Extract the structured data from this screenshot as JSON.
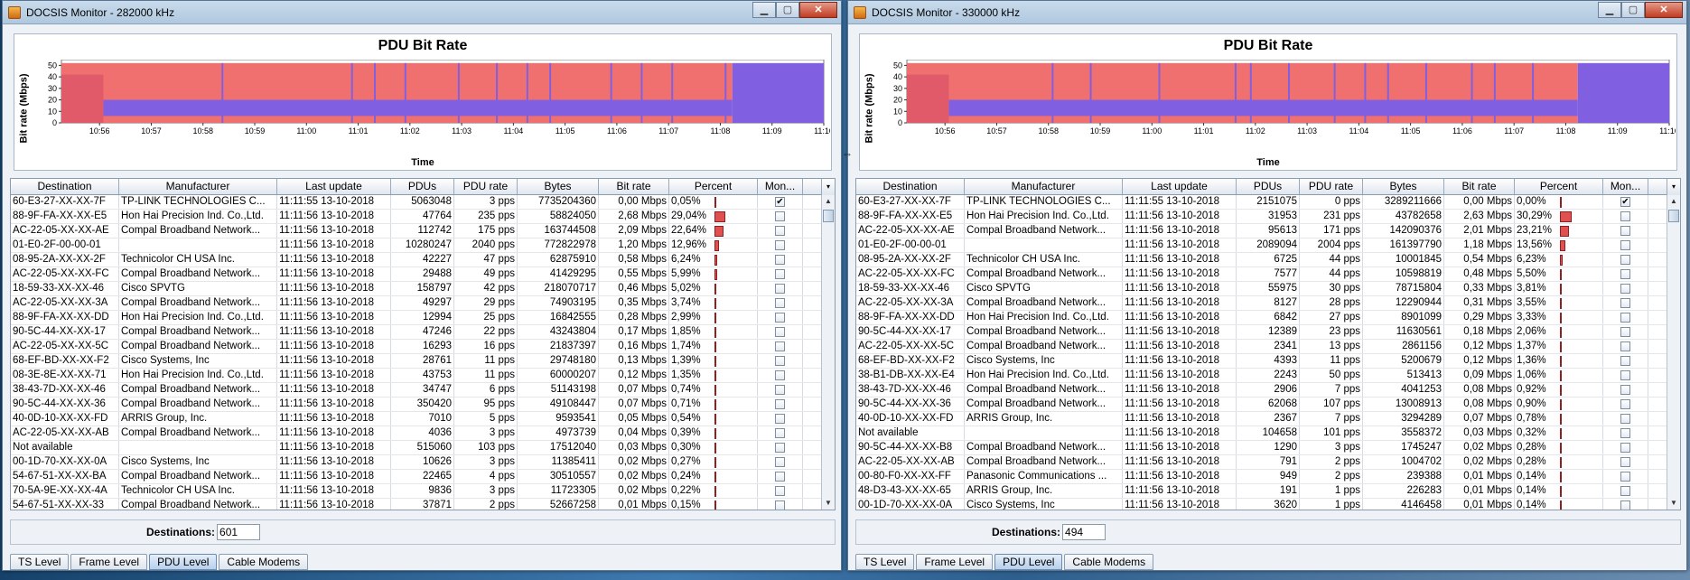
{
  "columns": [
    "Destination",
    "Manufacturer",
    "Last update",
    "PDUs",
    "PDU rate",
    "Bytes",
    "Bit rate",
    "Percent",
    "Mon..."
  ],
  "tabs": [
    "TS Level",
    "Frame Level",
    "PDU Level",
    "Cable Modems"
  ],
  "active_tab": "PDU Level",
  "dest_label": "Destinations:",
  "colors": {
    "series_data": "#f07070",
    "series_other": "#8060e0",
    "bar_red": "#e05050"
  },
  "windows": [
    {
      "title": "DOCSIS Monitor - 282000 kHz",
      "destinations": "601",
      "chart_data": {
        "type": "area",
        "title": "PDU Bit Rate",
        "ylabel": "Bit rate (Mbps)",
        "xlabel": "Time",
        "ylim": [
          0,
          55
        ],
        "yticks": [
          "0",
          "10",
          "20",
          "30",
          "40",
          "50"
        ],
        "xticks": [
          "10:56",
          "10:57",
          "10:58",
          "10:59",
          "11:00",
          "11:01",
          "11:02",
          "11:03",
          "11:04",
          "11:05",
          "11:06",
          "11:07",
          "11:08",
          "11:09",
          "11:10"
        ],
        "series": [
          {
            "name": "",
            "values": []
          }
        ],
        "legend": "none",
        "grid": false
      },
      "rows": [
        [
          "60-E3-27-XX-XX-7F",
          "TP-LINK TECHNOLOGIES C...",
          "11:11:55  13-10-2018",
          "5063048",
          "3 pps",
          "7735204360",
          "0,00 Mbps",
          "0,05%",
          true
        ],
        [
          "88-9F-FA-XX-XX-E5",
          "Hon Hai Precision Ind. Co.,Ltd.",
          "11:11:56  13-10-2018",
          "47764",
          "235 pps",
          "58824050",
          "2,68 Mbps",
          "29,04%",
          false
        ],
        [
          "AC-22-05-XX-XX-AE",
          "Compal Broadband Network...",
          "11:11:56  13-10-2018",
          "112742",
          "175 pps",
          "163744508",
          "2,09 Mbps",
          "22,64%",
          false
        ],
        [
          "01-E0-2F-00-00-01",
          "",
          "11:11:56  13-10-2018",
          "10280247",
          "2040 pps",
          "772822978",
          "1,20 Mbps",
          "12,96%",
          false
        ],
        [
          "08-95-2A-XX-XX-2F",
          "Technicolor CH USA Inc.",
          "11:11:56  13-10-2018",
          "42227",
          "47 pps",
          "62875910",
          "0,58 Mbps",
          "6,24%",
          false
        ],
        [
          "AC-22-05-XX-XX-FC",
          "Compal Broadband Network...",
          "11:11:56  13-10-2018",
          "29488",
          "49 pps",
          "41429295",
          "0,55 Mbps",
          "5,99%",
          false
        ],
        [
          "18-59-33-XX-XX-46",
          "Cisco SPVTG",
          "11:11:56  13-10-2018",
          "158797",
          "42 pps",
          "218070717",
          "0,46 Mbps",
          "5,02%",
          false
        ],
        [
          "AC-22-05-XX-XX-3A",
          "Compal Broadband Network...",
          "11:11:56  13-10-2018",
          "49297",
          "29 pps",
          "74903195",
          "0,35 Mbps",
          "3,74%",
          false
        ],
        [
          "88-9F-FA-XX-XX-DD",
          "Hon Hai Precision Ind. Co.,Ltd.",
          "11:11:56  13-10-2018",
          "12994",
          "25 pps",
          "16842555",
          "0,28 Mbps",
          "2,99%",
          false
        ],
        [
          "90-5C-44-XX-XX-17",
          "Compal Broadband Network...",
          "11:11:56  13-10-2018",
          "47246",
          "22 pps",
          "43243804",
          "0,17 Mbps",
          "1,85%",
          false
        ],
        [
          "AC-22-05-XX-XX-5C",
          "Compal Broadband Network...",
          "11:11:56  13-10-2018",
          "16293",
          "16 pps",
          "21837397",
          "0,16 Mbps",
          "1,74%",
          false
        ],
        [
          "68-EF-BD-XX-XX-F2",
          "Cisco Systems, Inc",
          "11:11:56  13-10-2018",
          "28761",
          "11 pps",
          "29748180",
          "0,13 Mbps",
          "1,39%",
          false
        ],
        [
          "08-3E-8E-XX-XX-71",
          "Hon Hai Precision Ind. Co.,Ltd.",
          "11:11:56  13-10-2018",
          "43753",
          "11 pps",
          "60000207",
          "0,12 Mbps",
          "1,35%",
          false
        ],
        [
          "38-43-7D-XX-XX-46",
          "Compal Broadband Network...",
          "11:11:56  13-10-2018",
          "34747",
          "6 pps",
          "51143198",
          "0,07 Mbps",
          "0,74%",
          false
        ],
        [
          "90-5C-44-XX-XX-36",
          "Compal Broadband Network...",
          "11:11:56  13-10-2018",
          "350420",
          "95 pps",
          "49108447",
          "0,07 Mbps",
          "0,71%",
          false
        ],
        [
          "40-0D-10-XX-XX-FD",
          "ARRIS Group, Inc.",
          "11:11:56  13-10-2018",
          "7010",
          "5 pps",
          "9593541",
          "0,05 Mbps",
          "0,54%",
          false
        ],
        [
          "AC-22-05-XX-XX-AB",
          "Compal Broadband Network...",
          "11:11:56  13-10-2018",
          "4036",
          "3 pps",
          "4973739",
          "0,04 Mbps",
          "0,39%",
          false
        ],
        [
          "Not available",
          "",
          "11:11:56  13-10-2018",
          "515060",
          "103 pps",
          "17512040",
          "0,03 Mbps",
          "0,30%",
          false
        ],
        [
          "00-1D-70-XX-XX-0A",
          "Cisco Systems, Inc",
          "11:11:56  13-10-2018",
          "10626",
          "3 pps",
          "11385411",
          "0,02 Mbps",
          "0,27%",
          false
        ],
        [
          "54-67-51-XX-XX-BA",
          "Compal Broadband Network...",
          "11:11:56  13-10-2018",
          "22465",
          "4 pps",
          "30510557",
          "0,02 Mbps",
          "0,24%",
          false
        ],
        [
          "70-5A-9E-XX-XX-4A",
          "Technicolor CH USA Inc.",
          "11:11:56  13-10-2018",
          "9836",
          "3 pps",
          "11723305",
          "0,02 Mbps",
          "0,22%",
          false
        ],
        [
          "54-67-51-XX-XX-33",
          "Compal Broadband Network...",
          "11:11:56  13-10-2018",
          "37871",
          "2 pps",
          "52667258",
          "0,01 Mbps",
          "0,15%",
          false
        ]
      ]
    },
    {
      "title": "DOCSIS Monitor - 330000 kHz",
      "destinations": "494",
      "chart_data": {
        "type": "area",
        "title": "PDU Bit Rate",
        "ylabel": "Bit rate (Mbps)",
        "xlabel": "Time",
        "ylim": [
          0,
          55
        ],
        "yticks": [
          "0",
          "10",
          "20",
          "30",
          "40",
          "50"
        ],
        "xticks": [
          "10:56",
          "10:57",
          "10:58",
          "10:59",
          "11:00",
          "11:01",
          "11:02",
          "11:03",
          "11:04",
          "11:05",
          "11:06",
          "11:07",
          "11:08",
          "11:09",
          "11:10"
        ],
        "series": [
          {
            "name": "",
            "values": []
          }
        ],
        "legend": "none",
        "grid": false
      },
      "rows": [
        [
          "60-E3-27-XX-XX-7F",
          "TP-LINK TECHNOLOGIES C...",
          "11:11:55  13-10-2018",
          "2151075",
          "0 pps",
          "3289211666",
          "0,00 Mbps",
          "0,00%",
          true
        ],
        [
          "88-9F-FA-XX-XX-E5",
          "Hon Hai Precision Ind. Co.,Ltd.",
          "11:11:56  13-10-2018",
          "31953",
          "231 pps",
          "43782658",
          "2,63 Mbps",
          "30,29%",
          false
        ],
        [
          "AC-22-05-XX-XX-AE",
          "Compal Broadband Network...",
          "11:11:56  13-10-2018",
          "95613",
          "171 pps",
          "142090376",
          "2,01 Mbps",
          "23,21%",
          false
        ],
        [
          "01-E0-2F-00-00-01",
          "",
          "11:11:56  13-10-2018",
          "2089094",
          "2004 pps",
          "161397790",
          "1,18 Mbps",
          "13,56%",
          false
        ],
        [
          "08-95-2A-XX-XX-2F",
          "Technicolor CH USA Inc.",
          "11:11:56  13-10-2018",
          "6725",
          "44 pps",
          "10001845",
          "0,54 Mbps",
          "6,23%",
          false
        ],
        [
          "AC-22-05-XX-XX-FC",
          "Compal Broadband Network...",
          "11:11:56  13-10-2018",
          "7577",
          "44 pps",
          "10598819",
          "0,48 Mbps",
          "5,50%",
          false
        ],
        [
          "18-59-33-XX-XX-46",
          "Cisco SPVTG",
          "11:11:56  13-10-2018",
          "55975",
          "30 pps",
          "78715804",
          "0,33 Mbps",
          "3,81%",
          false
        ],
        [
          "AC-22-05-XX-XX-3A",
          "Compal Broadband Network...",
          "11:11:56  13-10-2018",
          "8127",
          "28 pps",
          "12290944",
          "0,31 Mbps",
          "3,55%",
          false
        ],
        [
          "88-9F-FA-XX-XX-DD",
          "Hon Hai Precision Ind. Co.,Ltd.",
          "11:11:56  13-10-2018",
          "6842",
          "27 pps",
          "8901099",
          "0,29 Mbps",
          "3,33%",
          false
        ],
        [
          "90-5C-44-XX-XX-17",
          "Compal Broadband Network...",
          "11:11:56  13-10-2018",
          "12389",
          "23 pps",
          "11630561",
          "0,18 Mbps",
          "2,06%",
          false
        ],
        [
          "AC-22-05-XX-XX-5C",
          "Compal Broadband Network...",
          "11:11:56  13-10-2018",
          "2341",
          "13 pps",
          "2861156",
          "0,12 Mbps",
          "1,37%",
          false
        ],
        [
          "68-EF-BD-XX-XX-F2",
          "Cisco Systems, Inc",
          "11:11:56  13-10-2018",
          "4393",
          "11 pps",
          "5200679",
          "0,12 Mbps",
          "1,36%",
          false
        ],
        [
          "38-B1-DB-XX-XX-E4",
          "Hon Hai Precision Ind. Co.,Ltd.",
          "11:11:56  13-10-2018",
          "2243",
          "50 pps",
          "513413",
          "0,09 Mbps",
          "1,06%",
          false
        ],
        [
          "38-43-7D-XX-XX-46",
          "Compal Broadband Network...",
          "11:11:56  13-10-2018",
          "2906",
          "7 pps",
          "4041253",
          "0,08 Mbps",
          "0,92%",
          false
        ],
        [
          "90-5C-44-XX-XX-36",
          "Compal Broadband Network...",
          "11:11:56  13-10-2018",
          "62068",
          "107 pps",
          "13008913",
          "0,08 Mbps",
          "0,90%",
          false
        ],
        [
          "40-0D-10-XX-XX-FD",
          "ARRIS Group, Inc.",
          "11:11:56  13-10-2018",
          "2367",
          "7 pps",
          "3294289",
          "0,07 Mbps",
          "0,78%",
          false
        ],
        [
          "Not available",
          "",
          "11:11:56  13-10-2018",
          "104658",
          "101 pps",
          "3558372",
          "0,03 Mbps",
          "0,32%",
          false
        ],
        [
          "90-5C-44-XX-XX-B8",
          "Compal Broadband Network...",
          "11:11:56  13-10-2018",
          "1290",
          "3 pps",
          "1745247",
          "0,02 Mbps",
          "0,28%",
          false
        ],
        [
          "AC-22-05-XX-XX-AB",
          "Compal Broadband Network...",
          "11:11:56  13-10-2018",
          "791",
          "2 pps",
          "1004702",
          "0,02 Mbps",
          "0,28%",
          false
        ],
        [
          "00-80-F0-XX-XX-FF",
          "Panasonic Communications ...",
          "11:11:56  13-10-2018",
          "949",
          "2 pps",
          "239388",
          "0,01 Mbps",
          "0,14%",
          false
        ],
        [
          "48-D3-43-XX-XX-65",
          "ARRIS Group, Inc.",
          "11:11:56  13-10-2018",
          "191",
          "1 pps",
          "226283",
          "0,01 Mbps",
          "0,14%",
          false
        ],
        [
          "00-1D-70-XX-XX-0A",
          "Cisco Systems, Inc",
          "11:11:56  13-10-2018",
          "3620",
          "1 pps",
          "4146458",
          "0,01 Mbps",
          "0,14%",
          false
        ]
      ]
    }
  ]
}
